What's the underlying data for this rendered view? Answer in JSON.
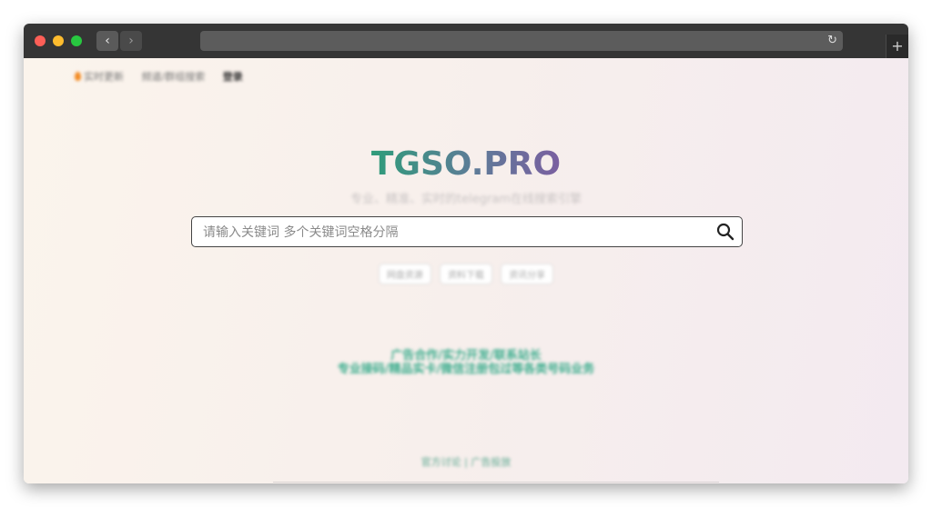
{
  "nav": {
    "realtime_label": "实时更新",
    "channels_label": "频道/群组搜索",
    "login_label": "登录"
  },
  "logo": "TGSO.PRO",
  "subtitle": "专业、精准、实时的telegram在线搜索引擎",
  "search": {
    "placeholder": "请输入关键词 多个关键词空格分隔",
    "value": ""
  },
  "tags": [
    "网盘资源",
    "资料下载",
    "资讯分享"
  ],
  "promo": {
    "line1": "广告合作/实力开发/联系站长",
    "line2": "专业接码/精品实卡/微信注册包过等各类号码业务"
  },
  "footer": "官方讨论 | 广告投放",
  "icons": {
    "back": "chevron-left-icon",
    "forward": "chevron-right-icon",
    "reload": "reload-icon",
    "new_tab": "plus-icon",
    "search": "search-icon"
  },
  "colors": {
    "accent": "#3fae8f",
    "logo_start": "#2f9c7a",
    "logo_end": "#7a5fa0"
  }
}
